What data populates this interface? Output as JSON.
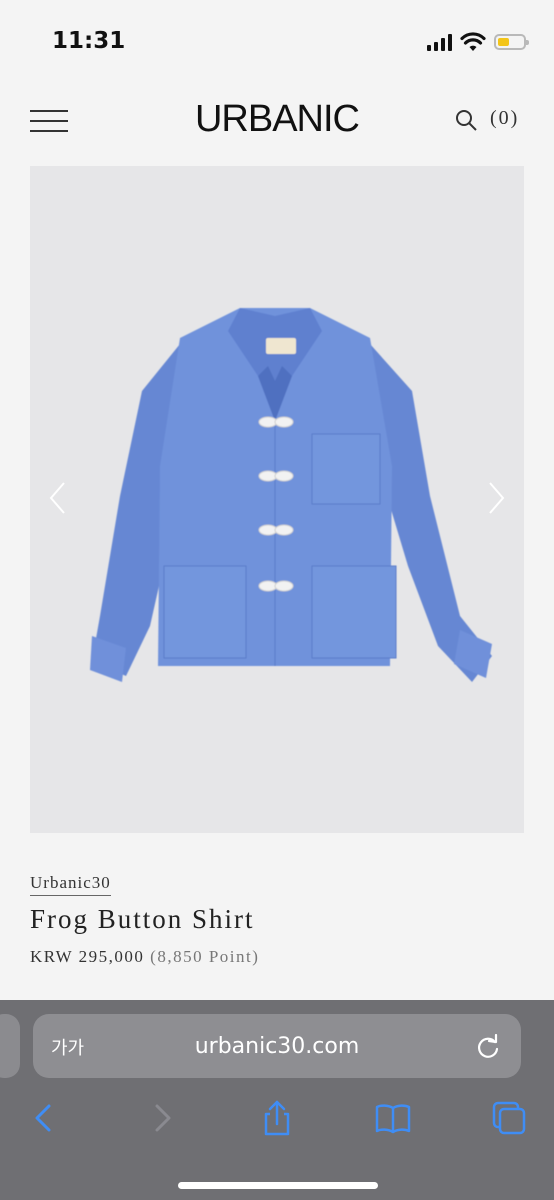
{
  "status_bar": {
    "time": "11:31",
    "battery_level": 0.45,
    "battery_color": "#f3c519"
  },
  "header": {
    "logo": "URBANIC",
    "cart_count": "(0)",
    "menu_icon": "hamburger-icon",
    "search_icon": "search-icon"
  },
  "product": {
    "image_description_icon": "shirt-image",
    "brand": "Urbanic30",
    "name": "Frog Button Shirt",
    "price": "KRW 295,000",
    "points": "(8,850 Point)"
  },
  "browser": {
    "text_size_label": "가가",
    "url": "urbanic30.com",
    "toolbar_icons": [
      "back-icon",
      "forward-icon",
      "share-icon",
      "bookmarks-icon",
      "tabs-icon"
    ]
  },
  "colors": {
    "shirt": "#6e8ed8",
    "bar_bg": "#6f6f73",
    "accent_blue": "#4a8ff0"
  }
}
